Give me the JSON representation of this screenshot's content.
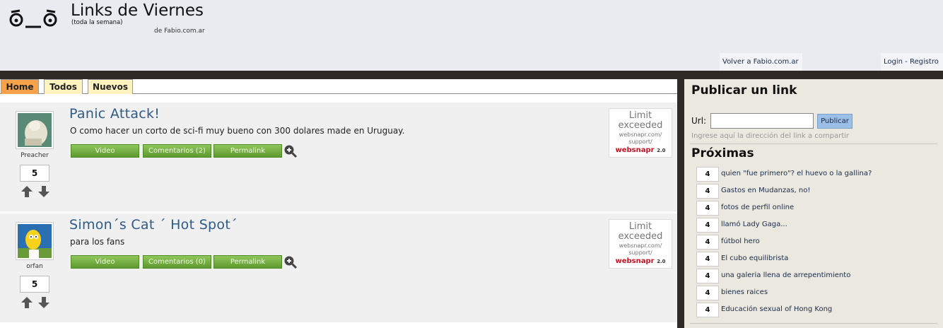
{
  "header": {
    "title": "Links de Viernes",
    "subtitle": "(toda la semana)",
    "author": "de Fabio.com.ar",
    "volver_link": "Volver a Fabio.com.ar",
    "login_link": "Login - Registro"
  },
  "tabs": [
    "Home",
    "Todos",
    "Nuevos"
  ],
  "active_tab": "Home",
  "items": [
    {
      "title": "Panic Attack!",
      "description": "O como hacer un corto de sci-fi muy bueno con 300 dolares made en Uruguay.",
      "poster": "Preacher",
      "votes": "5",
      "video_label": "Video",
      "comments_label": "Comentarios (2)",
      "permalink_label": "Permalink"
    },
    {
      "title": "Simon´s Cat ´ Hot Spot´",
      "description": "para los fans",
      "poster": "orfan",
      "votes": "5",
      "video_label": "Video",
      "comments_label": "Comentarios (0)",
      "permalink_label": "Permalink"
    }
  ],
  "thumb": {
    "line1": "Limit",
    "line2": "exceeded",
    "line3a": "websnapr.com/",
    "line3b": "support/",
    "brand": "websnapr",
    "version": "2.0"
  },
  "sidebar": {
    "publish_title": "Publicar un link",
    "url_label": "Url:",
    "url_value": "",
    "publish_button": "Publicar",
    "url_hint": "Ingrese aquí la dirección del link a compartir",
    "proximas_title": "Próximas",
    "proximas": [
      {
        "count": "4",
        "title": "quien \"fue primero\"? el huevo o la gallina?"
      },
      {
        "count": "4",
        "title": "Gastos en Mudanzas, no!"
      },
      {
        "count": "4",
        "title": "fotos de perfil online"
      },
      {
        "count": "4",
        "title": "llamó Lady Gaga..."
      },
      {
        "count": "4",
        "title": "fútbol hero"
      },
      {
        "count": "4",
        "title": "El cubo equilibrista"
      },
      {
        "count": "4",
        "title": "una galeria llena de arrepentimiento"
      },
      {
        "count": "4",
        "title": "bienes raices"
      },
      {
        "count": "4",
        "title": "Educación sexual of Hong Kong"
      }
    ]
  },
  "colors": {
    "active_tab": "#f6a24a",
    "tab": "#fff3c0",
    "button_green": "#6aa63a",
    "title_blue": "#2e5a88",
    "frame": "#2f2a26"
  },
  "icons": [
    "logo-face-icon",
    "arrow-up-icon",
    "arrow-down-icon",
    "zoom-in-icon"
  ]
}
